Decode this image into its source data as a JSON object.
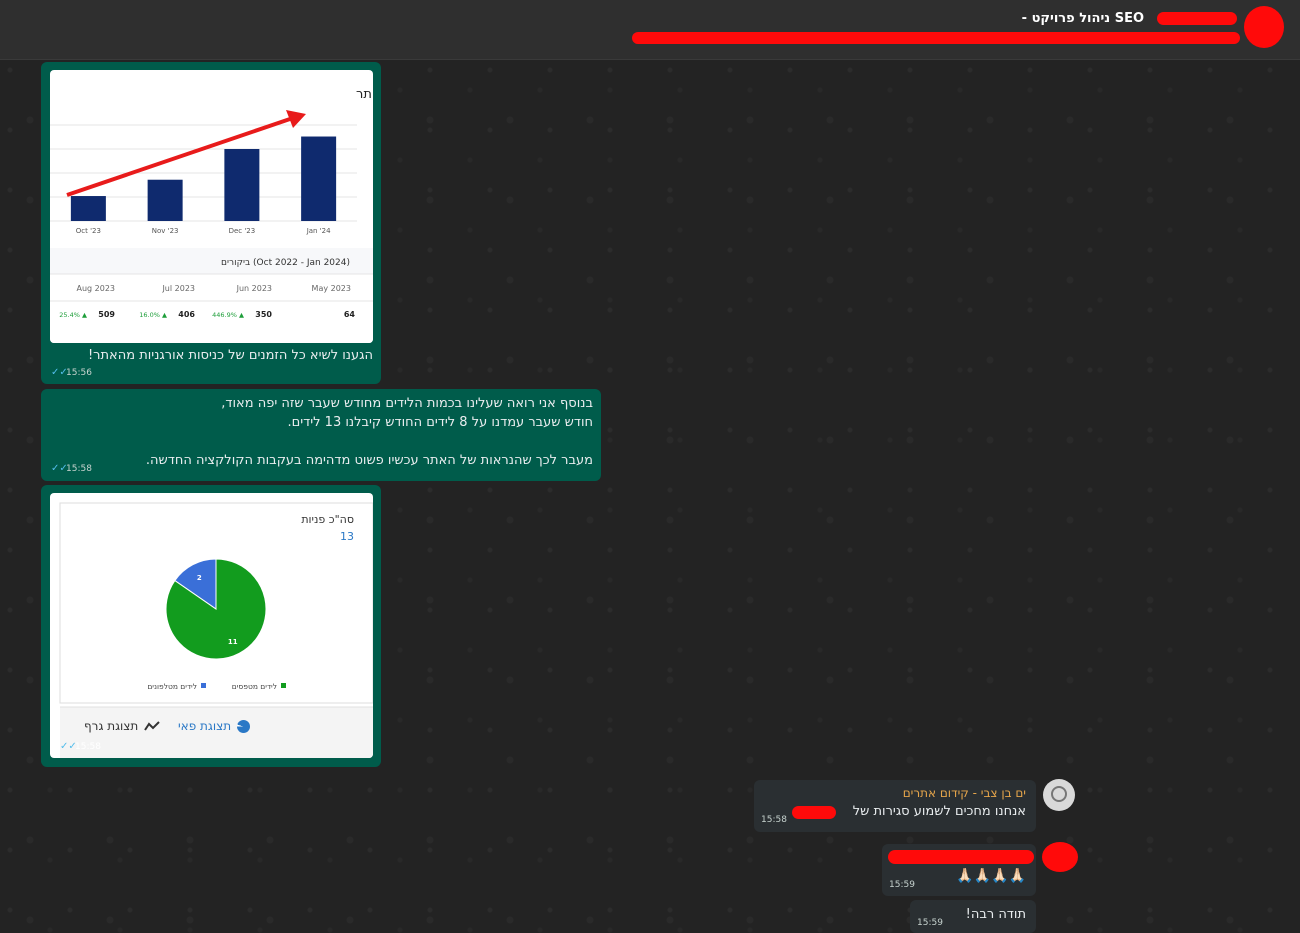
{
  "header": {
    "title": "SEO ניהול פרויקט - ",
    "subtitle_redacted": true
  },
  "messages": [
    {
      "id": "m1",
      "direction": "outgoing",
      "image": {
        "chart_title": "תנועה אורגנית (כלבד) לאתר",
        "table_caption": "ביקורים (Oct 2022 - Jan 2024)",
        "table_headers": [
          "Aug 2023",
          "Jul 2023",
          "Jun 2023",
          "May 2023"
        ],
        "table_values": [
          "509",
          "406",
          "350",
          "64"
        ],
        "table_changes": [
          "25.4% ▲",
          "16.0% ▲",
          "446.9% ▲",
          ""
        ]
      },
      "text": "הגענו לשיא כל הזמנים של כניסות אורגניות מהאתר!",
      "time": "15:56"
    },
    {
      "id": "m2",
      "direction": "outgoing",
      "lines": [
        "בנוסף אני רואה שעלינו בכמות הלידים מחודש שעבר שזה יפה מאוד,",
        "חודש שעבר עמדנו על 8 לידים החודש קיבלנו 13 לידים.",
        "",
        "מעבר לכך שהנראות של האתר עכשיו פשוט מדהימה בעקבות הקולקציה החדשה."
      ],
      "time": "15:58"
    },
    {
      "id": "m3",
      "direction": "outgoing",
      "image": {
        "title": "סה\"כ פניות",
        "total": "13",
        "legend": [
          "לידים מטפסים",
          "לידים מטלפונים"
        ],
        "btn_pie": "תצוגת פאי",
        "btn_graph": "תצוגת גרף"
      },
      "time": "15:58"
    },
    {
      "id": "m4",
      "direction": "incoming",
      "sender": "ים בן צבי - קידום אתרים",
      "text": "אנחנו מחכים לשמוע סגירות של",
      "time": "15:58"
    },
    {
      "id": "m5",
      "direction": "incoming",
      "text": "🙏🏻🙏🏻🙏🏻🙏🏻",
      "time": "15:59"
    },
    {
      "id": "m6",
      "direction": "incoming",
      "text": "תודה רבה!",
      "time": "15:59"
    }
  ],
  "chart_data": [
    {
      "type": "bar",
      "title": "תנועה אורגנית (כלבד) לאתר",
      "categories": [
        "Oct '23",
        "Nov '23",
        "Dec '23",
        "Jan '24"
      ],
      "values": [
        26,
        43,
        75,
        88
      ],
      "ylim": [
        0,
        100
      ],
      "grid": true,
      "annotation": "red upward trend arrow"
    },
    {
      "type": "pie",
      "title": "סה\"כ פניות",
      "labels": [
        "לידים מטפסים",
        "לידים מטלפונים"
      ],
      "values": [
        11,
        2
      ],
      "colors": [
        "#129c1e",
        "#3a6fd8"
      ]
    }
  ],
  "colors": {
    "outgoing_bubble": "#005c4b",
    "incoming_bubble": "#2a2f32",
    "redaction": "#ff0a0a",
    "sender_name": "#e5a54b",
    "read_ticks": "#53bdeb"
  }
}
